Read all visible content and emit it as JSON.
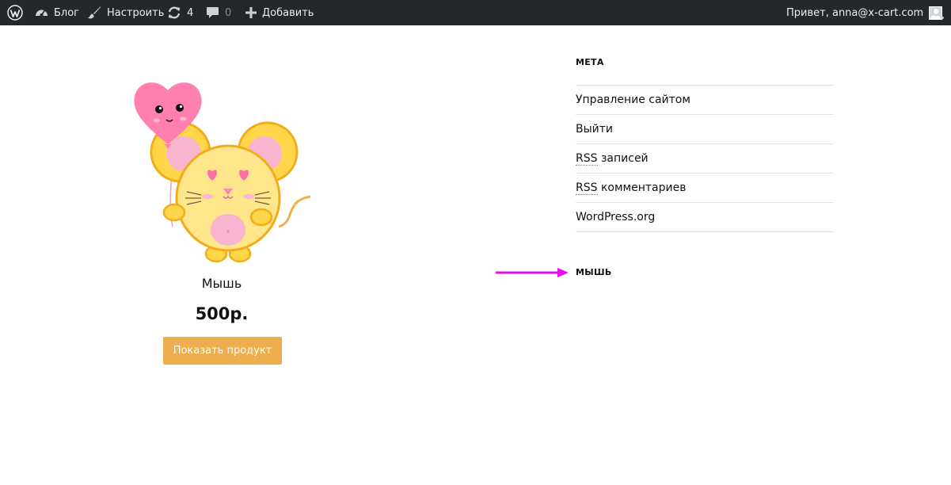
{
  "admin_bar": {
    "wp_logo_icon": "wordpress-logo-icon",
    "blog": {
      "icon": "dashboard-gauge-icon",
      "label": "Блог"
    },
    "customize": {
      "icon": "paintbrush-icon",
      "label": "Настроить"
    },
    "updates": {
      "icon": "refresh-icon",
      "count": "4"
    },
    "comments": {
      "icon": "speech-bubble-icon",
      "count": "0"
    },
    "new": {
      "icon": "plus-icon",
      "label": "Добавить"
    },
    "greeting": "Привет, anna@x-cart.com",
    "search_icon": "search-icon",
    "bg_color": "#23282d"
  },
  "product": {
    "image_alt": "Мышь",
    "name": "Мышь",
    "price": "500р.",
    "button_label": "Показать продукт",
    "button_color": "#efae4e"
  },
  "sidebar": {
    "meta_title": "МЕТА",
    "meta_items": [
      {
        "label": "Управление сайтом"
      },
      {
        "label": "Выйти"
      },
      {
        "abbr": "RSS",
        "rest": " записей"
      },
      {
        "abbr": "RSS",
        "rest": " комментариев"
      },
      {
        "label": "WordPress.org"
      }
    ],
    "second_title": "МЫШЬ"
  },
  "annotation": {
    "color": "#e60fe6",
    "icon": "arrow-right-icon"
  }
}
